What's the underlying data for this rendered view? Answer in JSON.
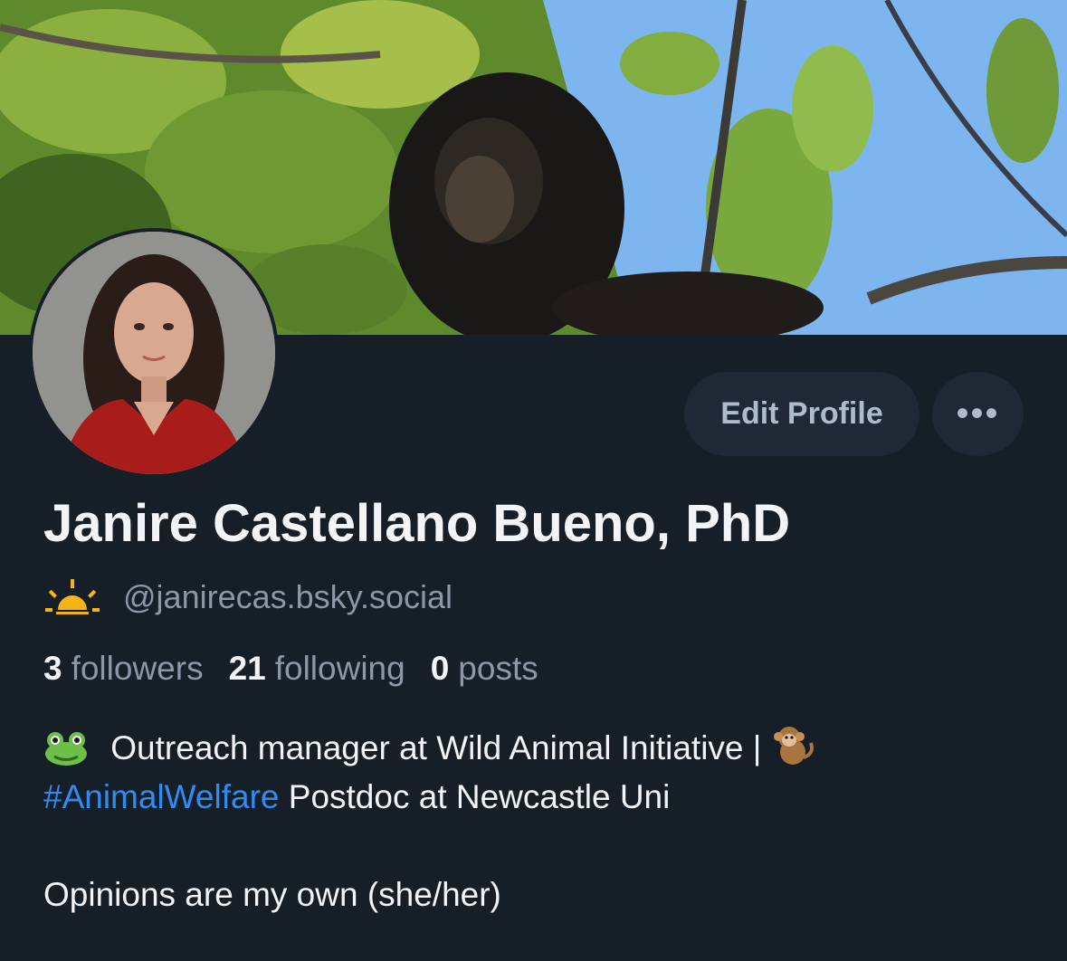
{
  "banner": {
    "description_icon": "banner-photo-monkey-in-tree"
  },
  "avatar": {
    "icon": "profile-photo"
  },
  "actions": {
    "edit_label": "Edit Profile",
    "more_label": "•••"
  },
  "profile": {
    "display_name": "Janire Castellano Bueno, PhD",
    "status_icon": "sunrise-icon",
    "handle": "@janirecas.bsky.social"
  },
  "stats": {
    "followers_count": "3",
    "followers_label": "followers",
    "following_count": "21",
    "following_label": "following",
    "posts_count": "0",
    "posts_label": "posts"
  },
  "bio": {
    "line1_text": "Outreach manager at Wild Animal Initiative | ",
    "line2_hashtag": "#AnimalWelfare",
    "line2_text": " Postdoc at Newcastle Uni",
    "line3_text": "Opinions are my own (she/her)"
  },
  "colors": {
    "background": "#161e27",
    "accent_link": "#2f8cf3",
    "button_bg": "#1e2935"
  }
}
